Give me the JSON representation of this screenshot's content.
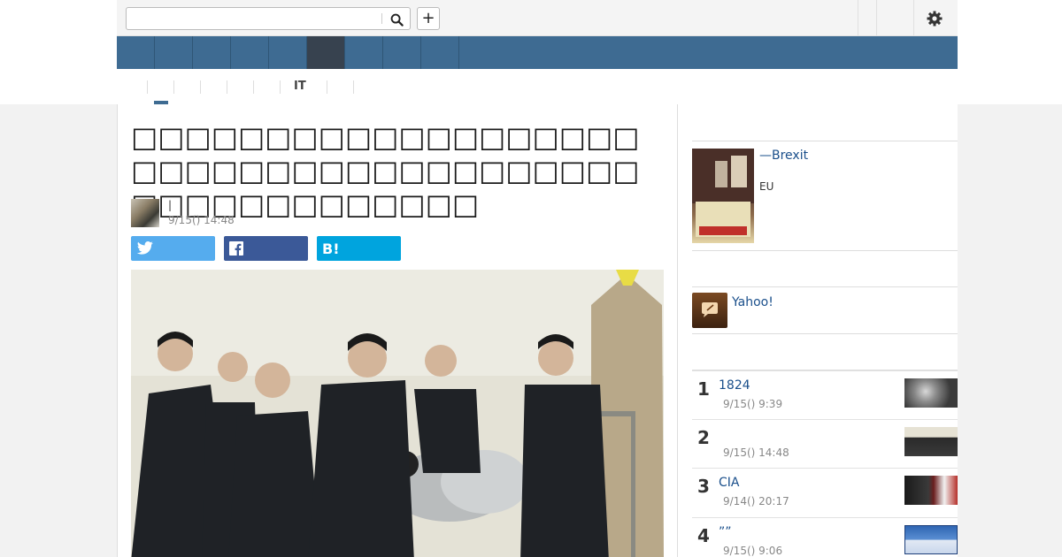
{
  "header": {
    "search": {
      "value": "",
      "placeholder": ""
    },
    "add_label": "+"
  },
  "subnav": {
    "label_it": "IT"
  },
  "article": {
    "title": "□□□□□□□□□□□□□□□□□□□□□□□□□□□□□□□□□□□□□□□□□□□□□□□□□□□",
    "author_line": "|",
    "date": "9/15() 14:48"
  },
  "share": {
    "hatena_label": "B!"
  },
  "sidebar": {
    "book": {
      "title": "—Brexit",
      "desc": "EU"
    },
    "yahoo_link": "Yahoo!",
    "ranking": [
      {
        "num": "1",
        "title": "1824",
        "date": "9/15() 9:39"
      },
      {
        "num": "2",
        "title": "",
        "date": "9/15() 14:48"
      },
      {
        "num": "3",
        "title": "CIA",
        "date": "9/14() 20:17"
      },
      {
        "num": "4",
        "title": "””",
        "date": "9/15() 9:06"
      }
    ]
  },
  "colors": {
    "nav": "#3e6b92",
    "nav_active": "#37424f",
    "twitter": "#55acee",
    "facebook": "#3b5998",
    "hatena": "#00a4de",
    "link": "#1a4f8b"
  }
}
